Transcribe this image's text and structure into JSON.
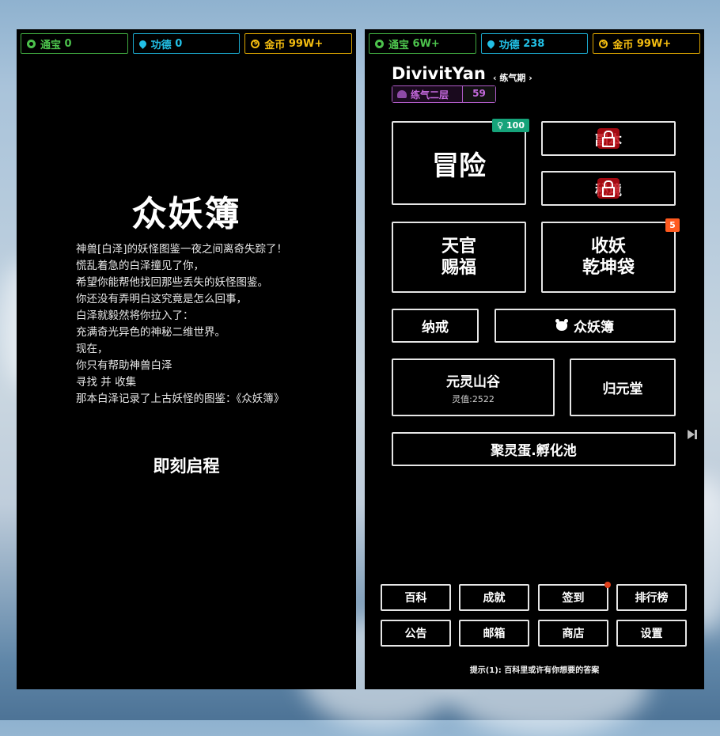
{
  "left_panel": {
    "resources": [
      {
        "icon": "token-icon",
        "label": "通宝",
        "value": "0"
      },
      {
        "icon": "merit-drop-icon",
        "label": "功德",
        "value": "0"
      },
      {
        "icon": "coin-icon",
        "label": "金币",
        "value": "99W+"
      }
    ],
    "title": "众妖簿",
    "story": [
      "神兽[白泽]的妖怪图鉴一夜之间离奇失踪了！",
      "慌乱着急的白泽撞见了你，",
      "希望你能帮他找回那些丢失的妖怪图鉴。",
      "你还没有弄明白这究竟是怎么回事，",
      "白泽就毅然将你拉入了：",
      "充满奇光异色的神秘二维世界。",
      "现在，",
      "你只有帮助神兽白泽",
      "寻找 并 收集",
      "那本白泽记录了上古妖怪的图鉴：《众妖簿》"
    ],
    "start_button": "即刻启程"
  },
  "right_panel": {
    "resources": [
      {
        "icon": "token-icon",
        "label": "通宝",
        "value": "6W+"
      },
      {
        "icon": "merit-drop-icon",
        "label": "功德",
        "value": "238"
      },
      {
        "icon": "coin-icon",
        "label": "金币",
        "value": "99W+"
      }
    ],
    "player": {
      "name": "DivivitYan",
      "stage": "‹ 练气期 ›",
      "level_label": "练气二层",
      "level_value": "59"
    },
    "tiles": {
      "adventure": {
        "label": "冒险",
        "badge": "♀ 100"
      },
      "dungeon": {
        "label": "副本",
        "locked": true
      },
      "secret_realm": {
        "label": "秘境",
        "locked": true
      },
      "blessing": {
        "line1": "天官",
        "line2": "赐福"
      },
      "demon_bag": {
        "line1": "收妖",
        "line2": "乾坤袋",
        "badge": "5"
      },
      "storage_ring": {
        "label": "纳戒"
      },
      "bestiary": {
        "label": "众妖簿"
      },
      "spirit_valley": {
        "label": "元灵山谷",
        "sub": "灵值:2522"
      },
      "guiyuan_hall": {
        "label": "归元堂"
      },
      "hatchery": {
        "label": "聚灵蛋.孵化池"
      }
    },
    "menu": [
      {
        "label": "百科"
      },
      {
        "label": "成就"
      },
      {
        "label": "签到",
        "dot": true
      },
      {
        "label": "排行榜"
      },
      {
        "label": "公告"
      },
      {
        "label": "邮箱"
      },
      {
        "label": "商店"
      },
      {
        "label": "设置"
      }
    ],
    "tip": "提示(1): 百科里或许有你想要的答案"
  }
}
